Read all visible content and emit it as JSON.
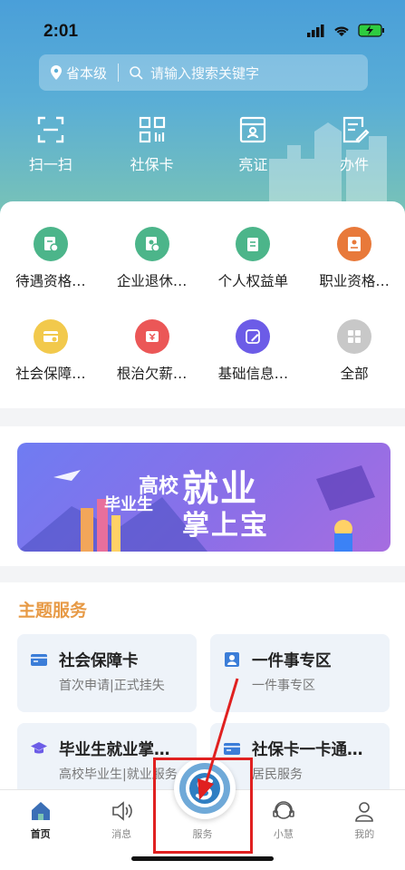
{
  "status_bar": {
    "time": "2:01"
  },
  "search": {
    "location": "省本级",
    "placeholder": "请输入搜索关键字"
  },
  "quick_actions": [
    {
      "label": "扫一扫",
      "icon": "scan-icon"
    },
    {
      "label": "社保卡",
      "icon": "qr-code-icon"
    },
    {
      "label": "亮证",
      "icon": "id-card-icon"
    },
    {
      "label": "办件",
      "icon": "edit-document-icon"
    }
  ],
  "services": [
    {
      "label": "待遇资格…",
      "icon": "qualification-icon",
      "color": "#4cb58a"
    },
    {
      "label": "企业退休…",
      "icon": "retirement-icon",
      "color": "#4cb58a"
    },
    {
      "label": "个人权益单",
      "icon": "rights-icon",
      "color": "#4cb58a"
    },
    {
      "label": "职业资格…",
      "icon": "certificate-icon",
      "color": "#e8793a"
    },
    {
      "label": "社会保障…",
      "icon": "card-icon",
      "color": "#f2c94c"
    },
    {
      "label": "根治欠薪…",
      "icon": "wage-icon",
      "color": "#eb5757"
    },
    {
      "label": "基础信息…",
      "icon": "info-edit-icon",
      "color": "#6c5ce7"
    },
    {
      "label": "全部",
      "icon": "all-apps-icon",
      "color": "#c8c8c8"
    }
  ],
  "banner": {
    "line_a": "高校",
    "line_b": "毕业生",
    "line_c": "就业",
    "line_d": "掌上宝"
  },
  "theme_services": {
    "title": "主题服务",
    "tiles": [
      {
        "title": "社会保障卡",
        "subtitle": "首次申请|正式挂失",
        "icon": "card-icon"
      },
      {
        "title": "一件事专区",
        "subtitle": "一件事专区",
        "icon": "person-card-icon"
      },
      {
        "title": "毕业生就业掌…",
        "subtitle": "高校毕业生|就业服务",
        "icon": "graduation-cap-icon"
      },
      {
        "title": "社保卡一卡通…",
        "subtitle": "居民服务",
        "icon": "card-icon"
      }
    ]
  },
  "tabbar": [
    {
      "label": "首页",
      "icon": "home-icon",
      "active": true
    },
    {
      "label": "消息",
      "icon": "speaker-icon",
      "active": false
    },
    {
      "label": "服务",
      "icon": "service-logo-icon",
      "active": false
    },
    {
      "label": "小慧",
      "icon": "headset-icon",
      "active": false
    },
    {
      "label": "我的",
      "icon": "user-icon",
      "active": false
    }
  ],
  "colors": {
    "accent": "#e79a46",
    "highlight": "#e02020",
    "hero_top": "#4a9fd9",
    "hero_bottom": "#7cc5b3"
  }
}
